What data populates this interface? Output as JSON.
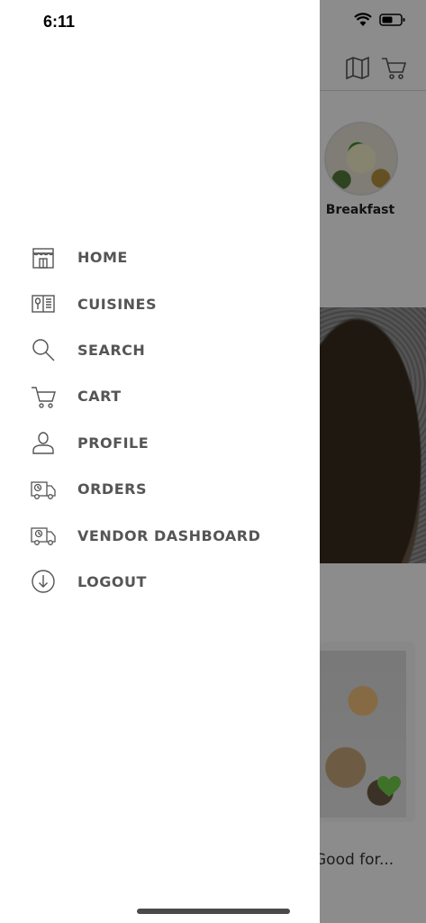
{
  "status_bar": {
    "time": "6:11"
  },
  "background": {
    "category_label": "Breakfast",
    "card_text": "Good for..."
  },
  "drawer": {
    "items": [
      {
        "label": "HOME",
        "icon": "store-icon"
      },
      {
        "label": "CUISINES",
        "icon": "menu-book-icon"
      },
      {
        "label": "SEARCH",
        "icon": "search-icon"
      },
      {
        "label": "CART",
        "icon": "cart-icon"
      },
      {
        "label": "PROFILE",
        "icon": "user-icon"
      },
      {
        "label": "ORDERS",
        "icon": "truck-icon"
      },
      {
        "label": "VENDOR DASHBOARD",
        "icon": "truck-clock-icon"
      },
      {
        "label": "LOGOUT",
        "icon": "logout-icon"
      }
    ]
  },
  "colors": {
    "drawer_bg": "#ffffff",
    "menu_text": "#555555",
    "overlay": "rgba(0,0,0,0.45)"
  }
}
